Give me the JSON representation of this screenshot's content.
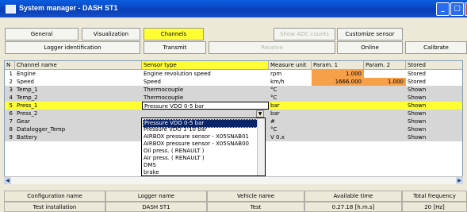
{
  "window": {
    "title": "System manager - DASH ST1"
  },
  "toolbar_row1": [
    {
      "label": "General",
      "state": "normal"
    },
    {
      "label": "Visualization",
      "state": "normal"
    },
    {
      "label": "Channels",
      "state": "active"
    },
    {
      "label": "Show ADC counts",
      "state": "disabled"
    },
    {
      "label": "Customize sensor",
      "state": "normal"
    }
  ],
  "toolbar_row2": [
    {
      "label": "Logger identification",
      "state": "normal"
    },
    {
      "label": "Transmit",
      "state": "normal"
    },
    {
      "label": "Receive",
      "state": "disabled"
    },
    {
      "label": "Online",
      "state": "normal"
    },
    {
      "label": "Calibrate",
      "state": "normal"
    }
  ],
  "grid": {
    "columns": [
      "N",
      "Channel name",
      "Sensor type",
      "Measure unit",
      "Param. 1",
      "Param. 2",
      "Stored"
    ],
    "rows": [
      {
        "n": "1",
        "name": "Engine",
        "sensor": "Engine revolution speed",
        "unit": "rpm",
        "p1": "1.000",
        "p2": "",
        "stored": "Stored"
      },
      {
        "n": "2",
        "name": "Speed",
        "sensor": "Speed",
        "unit": "km/h",
        "p1": "1666.000",
        "p2": "1.000",
        "stored": "Stored"
      },
      {
        "n": "3",
        "name": "Temp_1",
        "sensor": "Thermocouple",
        "unit": "°C",
        "p1": "",
        "p2": "",
        "stored": "Shown"
      },
      {
        "n": "4",
        "name": "Temp_2",
        "sensor": "Thermocouple",
        "unit": "°C",
        "p1": "",
        "p2": "",
        "stored": "Shown"
      },
      {
        "n": "5",
        "name": "Press_1",
        "sensor": "Pressure VDO 0-5 bar",
        "unit": "bar",
        "p1": "",
        "p2": "",
        "stored": "Shown"
      },
      {
        "n": "6",
        "name": "Press_2",
        "sensor": "",
        "unit": "bar",
        "p1": "",
        "p2": "",
        "stored": "Shown"
      },
      {
        "n": "7",
        "name": "Gear",
        "sensor": "",
        "unit": "#",
        "p1": "",
        "p2": "",
        "stored": "Shown"
      },
      {
        "n": "8",
        "name": "Datalogger_Temp",
        "sensor": "",
        "unit": "°C",
        "p1": "",
        "p2": "",
        "stored": "Shown"
      },
      {
        "n": "9",
        "name": "Battery",
        "sensor": "",
        "unit": "V  0.x",
        "p1": "",
        "p2": "",
        "stored": "Shown"
      }
    ]
  },
  "dropdown": {
    "selected": "Pressure VDO 0-5 bar",
    "options": [
      "Pressure VDO 0-5 bar",
      "Pressure VDO 1-10 bar",
      "AIRBOX pressure sensor - X05SNAB01",
      "AIRBOX pressure sensor - X05SNAB00",
      "Oil press. ( RENAULT )",
      "Air press. ( RENAULT )",
      "DMS",
      "brake"
    ]
  },
  "footer": {
    "headers": [
      "Configuration name",
      "Logger name",
      "Vehicle name",
      "Available time",
      "Total frequency"
    ],
    "values": [
      "Test installation",
      "DASH ST1",
      "Test",
      "0.27.18 [h.m.s]",
      "20 [Hz]"
    ]
  },
  "colors": {
    "accent_yellow": "#ffff33",
    "orange": "#f7a04a",
    "row_gray": "#d6d6d6",
    "title_blue": "#0a3fb8"
  }
}
